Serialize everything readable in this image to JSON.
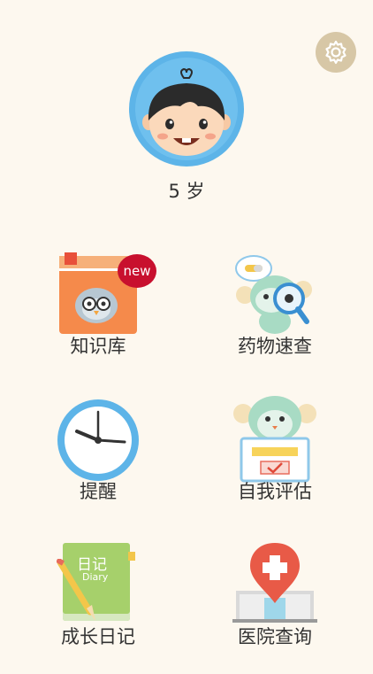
{
  "profile": {
    "age_label": "5 岁"
  },
  "badges": {
    "new": "new"
  },
  "menu": [
    {
      "label": "知识库"
    },
    {
      "label": "药物速查"
    },
    {
      "label": "提醒"
    },
    {
      "label": "自我评估"
    },
    {
      "label": "成长日记"
    },
    {
      "label": "医院查询"
    }
  ],
  "diary": {
    "title": "日记",
    "subtitle": "Diary"
  },
  "icons": {
    "settings": "gear-icon",
    "avatar": "boy-avatar",
    "knowledge": "book-owl-icon",
    "drug": "monkey-magnifier-icon",
    "reminder": "clock-icon",
    "assessment": "monkey-checklist-icon",
    "diary": "diary-book-icon",
    "hospital": "hospital-pin-icon"
  },
  "colors": {
    "background": "#fdf8ef",
    "avatar_ring": "#5db4e8",
    "settings_bg": "#d7c7a6",
    "badge": "#c8102e"
  }
}
